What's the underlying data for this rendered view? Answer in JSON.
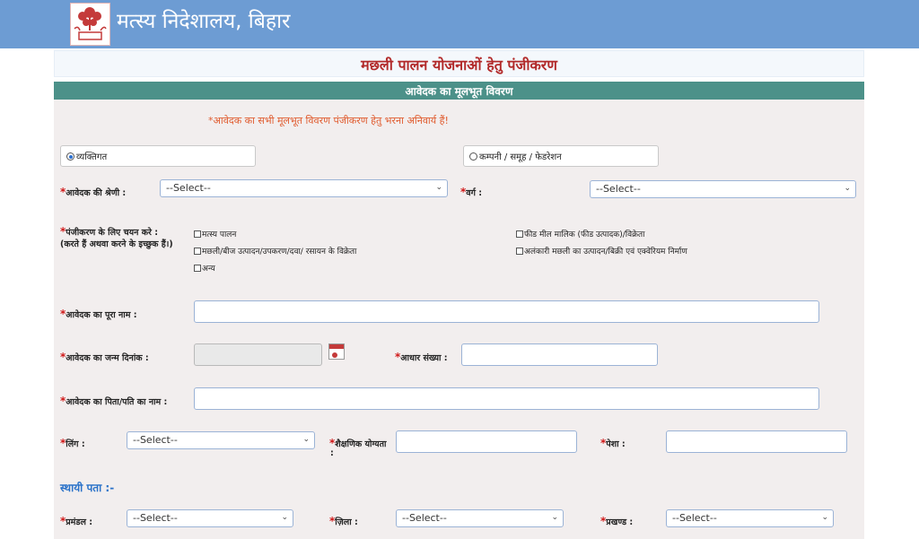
{
  "header": {
    "site_title": "मत्स्य निदेशालय, बिहार"
  },
  "form": {
    "title": "मछली पालन योजनाओं हेतु पंजीकरण",
    "section_title": "आवेदक का मूलभूत विवरण",
    "mandatory_note": "*आवेदक का सभी मूलभूत विवरण पंजीकरण हेतु भरना अनिवार्य हैं!"
  },
  "applicant_type": {
    "individual": "व्यक्तिगत",
    "company": "कम्पनी / समूह / फेडरेशन",
    "selected": "individual"
  },
  "fields": {
    "category_label": "आवेदक की श्रेणी :",
    "category_value": "--Select--",
    "class_label": "वर्ग :",
    "class_value": "--Select--",
    "register_label": "पंजीकरण के लिए चयन करे :",
    "register_sub": "(करते हैं अथवा करने के इच्छुक हैं।)",
    "name_label": "आवेदक का पूरा नाम :",
    "dob_label": "आवेदक का जन्म दिनांक :",
    "aadhar_label": "आधार संख्या :",
    "father_label": "आवेदक का पिता/पति का नाम :",
    "gender_label": "लिंग :",
    "gender_value": "--Select--",
    "edu_label": "शैक्षणिक योग्यता",
    "edu_colon": ":",
    "occupation_label": "पेशा :",
    "permanent_address": "स्थायी पता :-",
    "division_label": "प्रमंडल :",
    "division_value": "--Select--",
    "district_label": "ज़िला :",
    "district_value": "--Select--",
    "block_label": "प्रखण्ड :",
    "block_value": "--Select--"
  },
  "checkboxes": {
    "fish_farming": "मत्स्य पालन",
    "seller": "मछली/बीज उत्पादन/उपकरण/दवा/ रसायन के विक्रेता",
    "other": "अन्य",
    "feed_mill": "फीड मील मालिक (फीड उत्पादक)/विक्रेता",
    "ornamental": "अलंकारी मछली का उत्पादन/बिक्री एवं एक्वेरियम निर्माण"
  },
  "icons": {
    "logo": "bihar-bodhi-tree-logo",
    "calendar": "calendar-icon",
    "dropdown": "chevron-down-icon"
  },
  "colors": {
    "topbar": "#6d9cd3",
    "section": "#4c9189",
    "title": "#b22a2a",
    "required": "#d01818",
    "link_blue": "#2a72c9"
  }
}
